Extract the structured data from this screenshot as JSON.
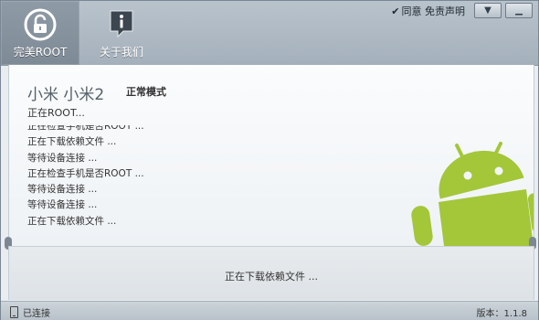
{
  "toolbar": {
    "root_label": "完美ROOT",
    "about_label": "关于我们",
    "agree_label": "同意",
    "disclaimer_label": "免责声明"
  },
  "window_controls": {
    "menu_symbol": "▼",
    "minimize_symbol": "▁"
  },
  "device": {
    "name": "小米 小米2",
    "mode": "正常模式"
  },
  "status_line": "正在ROOT...",
  "log": [
    "正在检查手机是否ROOT ...",
    "正在下载依赖文件 ...",
    "等待设备连接 ...",
    "正在检查手机是否ROOT ...",
    "等待设备连接 ...",
    "等待设备连接 ...",
    "正在下载依赖文件 ..."
  ],
  "progress": {
    "text": "正在下载依赖文件 ..."
  },
  "statusbar": {
    "connection": "已连接",
    "version": "版本：1.1.8"
  },
  "icons": {
    "root": "unlock-icon",
    "about": "info-icon",
    "mascot": "android-icon",
    "phone": "phone-icon"
  },
  "colors": {
    "toolbar": "#a9b4be",
    "android_green": "#a4c639",
    "android_shadow": "#8aa82d"
  }
}
